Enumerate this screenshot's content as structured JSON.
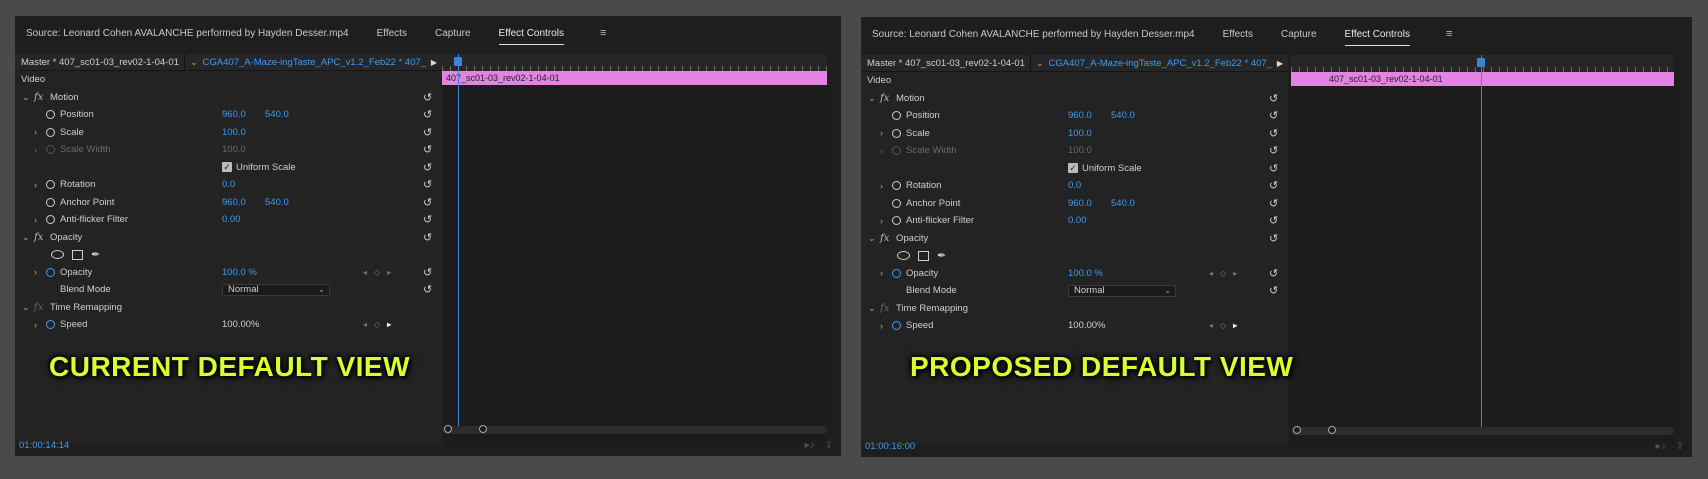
{
  "tabs": [
    {
      "label": "Source: Leonard Cohen AVALANCHE performed by Hayden Desser.mp4"
    },
    {
      "label": "Effects"
    },
    {
      "label": "Capture"
    },
    {
      "label": "Effect Controls"
    }
  ],
  "menu_icon": "hamburger-icon",
  "seq_master": "Master * 407_sc01-03_rev02-1-04-01",
  "seq_clip": "CGA407_A-Maze-ingTaste_APC_v1.2_Feb22 * 407_...",
  "clip_name": "407_sc01-03_rev02-1-04-01",
  "section_video": "Video",
  "motion": {
    "label": "Motion",
    "position": {
      "label": "Position",
      "x": "960.0",
      "y": "540.0"
    },
    "scale": {
      "label": "Scale",
      "value": "100.0"
    },
    "scale_width": {
      "label": "Scale Width",
      "value": "100.0"
    },
    "uniform_scale": {
      "label": "Uniform Scale",
      "checked": true
    },
    "rotation": {
      "label": "Rotation",
      "value": "0.0"
    },
    "anchor": {
      "label": "Anchor Point",
      "x": "960.0",
      "y": "540.0"
    },
    "antiflicker": {
      "label": "Anti-flicker Filter",
      "value": "0.00"
    }
  },
  "opacity": {
    "label": "Opacity",
    "opacity": {
      "label": "Opacity",
      "value": "100.0 %"
    },
    "blend": {
      "label": "Blend Mode",
      "value": "Normal"
    }
  },
  "time_remap": {
    "label": "Time Remapping",
    "speed": {
      "label": "Speed",
      "value": "100.00%"
    }
  },
  "panels": [
    {
      "timecode": "01:00:14:14",
      "caption": "CURRENT DEFAULT VIEW"
    },
    {
      "timecode": "01:00:16:00",
      "caption": "PROPOSED DEFAULT VIEW"
    }
  ],
  "colors": {
    "accent": "#3d9bf5",
    "clip": "#e384e2",
    "caption": "#d7ff2e"
  }
}
